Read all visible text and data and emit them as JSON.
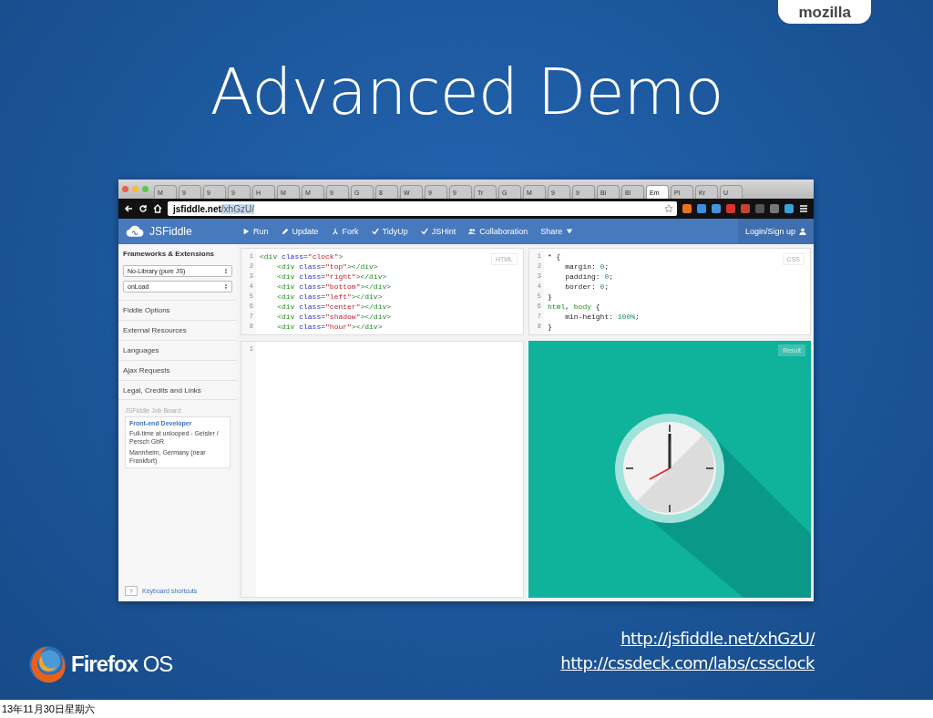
{
  "slide": {
    "brand": "mozilla",
    "title": "Advanced Demo",
    "date": "13年11月30日星期六"
  },
  "browser": {
    "tabs": [
      {
        "label": "M",
        "selected": false
      },
      {
        "label": "9",
        "selected": false
      },
      {
        "label": "9",
        "selected": false
      },
      {
        "label": "9",
        "selected": false
      },
      {
        "label": "H",
        "selected": false
      },
      {
        "label": "M",
        "selected": false
      },
      {
        "label": "M",
        "selected": false
      },
      {
        "label": "9",
        "selected": false
      },
      {
        "label": "G",
        "selected": false
      },
      {
        "label": "8",
        "selected": false
      },
      {
        "label": "W",
        "selected": false
      },
      {
        "label": "9",
        "selected": false
      },
      {
        "label": "9",
        "selected": false
      },
      {
        "label": "Tr",
        "selected": false
      },
      {
        "label": "G",
        "selected": false
      },
      {
        "label": "M",
        "selected": false
      },
      {
        "label": "9",
        "selected": false
      },
      {
        "label": "9",
        "selected": false
      },
      {
        "label": "Bi",
        "selected": false
      },
      {
        "label": "Bi",
        "selected": false
      },
      {
        "label": "Em",
        "selected": true
      },
      {
        "label": "Pi",
        "selected": false
      },
      {
        "label": "Kr",
        "selected": false
      },
      {
        "label": "U",
        "selected": false
      }
    ],
    "url": {
      "host": "jsfiddle.net",
      "path": "/xhGzU/"
    }
  },
  "jsfiddle": {
    "logo": "JSFiddle",
    "actions": [
      {
        "label": "Run",
        "kind": "play"
      },
      {
        "label": "Update",
        "kind": "pencil"
      },
      {
        "label": "Fork",
        "kind": "fork"
      },
      {
        "label": "TidyUp",
        "kind": "check"
      },
      {
        "label": "JSHint",
        "kind": "check"
      },
      {
        "label": "Collaboration",
        "kind": "people"
      },
      {
        "label": "Share",
        "kind": "caret"
      }
    ],
    "login": "Login/Sign up",
    "sidebar": {
      "heading": "Frameworks & Extensions",
      "selects": [
        "No-Library (pure JS)",
        "onLoad"
      ],
      "items": [
        "Fiddle Options",
        "External Resources",
        "Languages",
        "Ajax Requests",
        "Legal, Credits and Links"
      ],
      "job_board": {
        "heading": "JSFiddle Job Board:",
        "title": "Front-end Developer",
        "company": "Full-time at unlooped - Geisler / Persch GbR",
        "location": "Mannheim, Germany (near Frankfurt)"
      },
      "shortcut_key": "?",
      "shortcuts": "Keyboard shortcuts"
    },
    "html_panel": {
      "label": "HTML",
      "lines": [
        {
          "n": "1",
          "tokens": [
            {
              "t": "<div",
              "kind": "tag"
            },
            {
              "t": " class",
              "kind": "attr"
            },
            {
              "t": "=",
              "kind": "plain"
            },
            {
              "t": "\"clock\"",
              "kind": "str"
            },
            {
              "t": ">",
              "kind": "tag"
            }
          ]
        },
        {
          "n": "2",
          "tokens": [
            {
              "t": "    <div",
              "kind": "tag"
            },
            {
              "t": " class",
              "kind": "attr"
            },
            {
              "t": "=",
              "kind": "plain"
            },
            {
              "t": "\"top\"",
              "kind": "str"
            },
            {
              "t": "></div>",
              "kind": "tag"
            }
          ]
        },
        {
          "n": "3",
          "tokens": [
            {
              "t": "    <div",
              "kind": "tag"
            },
            {
              "t": " class",
              "kind": "attr"
            },
            {
              "t": "=",
              "kind": "plain"
            },
            {
              "t": "\"right\"",
              "kind": "str"
            },
            {
              "t": "></div>",
              "kind": "tag"
            }
          ]
        },
        {
          "n": "4",
          "tokens": [
            {
              "t": "    <div",
              "kind": "tag"
            },
            {
              "t": " class",
              "kind": "attr"
            },
            {
              "t": "=",
              "kind": "plain"
            },
            {
              "t": "\"bottom\"",
              "kind": "str"
            },
            {
              "t": "></div>",
              "kind": "tag"
            }
          ]
        },
        {
          "n": "5",
          "tokens": [
            {
              "t": "    <div",
              "kind": "tag"
            },
            {
              "t": " class",
              "kind": "attr"
            },
            {
              "t": "=",
              "kind": "plain"
            },
            {
              "t": "\"left\"",
              "kind": "str"
            },
            {
              "t": "></div>",
              "kind": "tag"
            }
          ]
        },
        {
          "n": "6",
          "tokens": [
            {
              "t": "    <div",
              "kind": "tag"
            },
            {
              "t": " class",
              "kind": "attr"
            },
            {
              "t": "=",
              "kind": "plain"
            },
            {
              "t": "\"center\"",
              "kind": "str"
            },
            {
              "t": "></div>",
              "kind": "tag"
            }
          ]
        },
        {
          "n": "7",
          "tokens": [
            {
              "t": "    <div",
              "kind": "tag"
            },
            {
              "t": " class",
              "kind": "attr"
            },
            {
              "t": "=",
              "kind": "plain"
            },
            {
              "t": "\"shadow\"",
              "kind": "str"
            },
            {
              "t": "></div>",
              "kind": "tag"
            }
          ]
        },
        {
          "n": "8",
          "tokens": [
            {
              "t": "    <div",
              "kind": "tag"
            },
            {
              "t": " class",
              "kind": "attr"
            },
            {
              "t": "=",
              "kind": "plain"
            },
            {
              "t": "\"hour\"",
              "kind": "str"
            },
            {
              "t": "></div>",
              "kind": "tag"
            }
          ]
        }
      ]
    },
    "css_panel": {
      "label": "CSS",
      "lines": [
        {
          "n": "1",
          "tokens": [
            {
              "t": "* {",
              "kind": "plain"
            }
          ]
        },
        {
          "n": "2",
          "tokens": [
            {
              "t": "    margin: ",
              "kind": "plain"
            },
            {
              "t": "0",
              "kind": "num"
            },
            {
              "t": ";",
              "kind": "plain"
            }
          ]
        },
        {
          "n": "3",
          "tokens": [
            {
              "t": "    padding: ",
              "kind": "plain"
            },
            {
              "t": "0",
              "kind": "num"
            },
            {
              "t": ";",
              "kind": "plain"
            }
          ]
        },
        {
          "n": "4",
          "tokens": [
            {
              "t": "    border: ",
              "kind": "plain"
            },
            {
              "t": "0",
              "kind": "num"
            },
            {
              "t": ";",
              "kind": "plain"
            }
          ]
        },
        {
          "n": "5",
          "tokens": [
            {
              "t": "}",
              "kind": "plain"
            }
          ]
        },
        {
          "n": "6",
          "tokens": [
            {
              "t": "html",
              "kind": "tag"
            },
            {
              "t": ", ",
              "kind": "plain"
            },
            {
              "t": "body",
              "kind": "tag"
            },
            {
              "t": " {",
              "kind": "plain"
            }
          ]
        },
        {
          "n": "7",
          "tokens": [
            {
              "t": "    min-height: ",
              "kind": "plain"
            },
            {
              "t": "100%",
              "kind": "num"
            },
            {
              "t": ";",
              "kind": "plain"
            }
          ]
        },
        {
          "n": "8",
          "tokens": [
            {
              "t": "}",
              "kind": "plain"
            }
          ]
        }
      ]
    },
    "js_panel": {
      "line_numbers": [
        "1"
      ]
    },
    "result_panel": {
      "label": "Result"
    }
  },
  "footer": {
    "logo": {
      "name": "Firefox",
      "suffix": "OS"
    },
    "links": [
      "http://jsfiddle.net/xhGzU/",
      "http://cssdeck.com/labs/cssclock"
    ]
  }
}
